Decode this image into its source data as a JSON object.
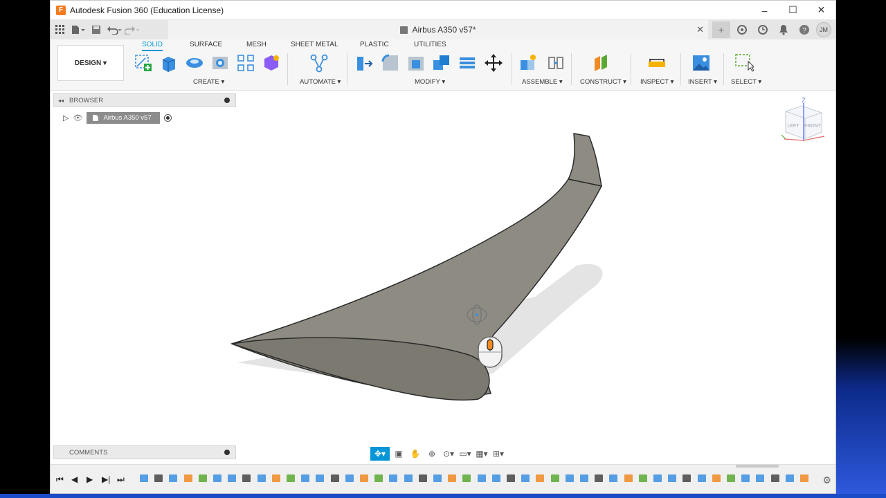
{
  "window": {
    "title": "Autodesk Fusion 360 (Education License)",
    "controls": [
      "–",
      "☐",
      "✕"
    ]
  },
  "document_tab": {
    "title": "Airbus A350 v57*"
  },
  "user": {
    "initials": "JM"
  },
  "ribbon": {
    "workspace": "DESIGN ▾",
    "tabs": [
      {
        "label": "SOLID",
        "active": true
      },
      {
        "label": "SURFACE",
        "active": false
      },
      {
        "label": "MESH",
        "active": false
      },
      {
        "label": "SHEET METAL",
        "active": false
      },
      {
        "label": "PLASTIC",
        "active": false
      },
      {
        "label": "UTILITIES",
        "active": false
      }
    ],
    "groups": [
      "CREATE ▾",
      "AUTOMATE ▾",
      "MODIFY ▾",
      "ASSEMBLE ▾",
      "CONSTRUCT ▾",
      "INSPECT ▾",
      "INSERT ▾",
      "SELECT ▾"
    ]
  },
  "browser": {
    "title": "BROWSER",
    "root_item": "Airbus A350 v57"
  },
  "comments": {
    "title": "COMMENTS"
  },
  "viewcube": {
    "left": "LEFT",
    "front": "FRONT",
    "axis": "Z"
  },
  "colors": {
    "accent": "#0696d7",
    "model_fill": "#8e8c82",
    "model_edge": "#2a2a2a",
    "toolbar_blue": "#3a8fe0"
  },
  "icons": {
    "nav": [
      "orbit-icon",
      "look-at-icon",
      "pan-icon",
      "zoom-icon",
      "fit-icon",
      "display-settings-icon",
      "grid-icon",
      "viewports-icon"
    ],
    "timeline_controls": [
      "first",
      "previous",
      "play",
      "next",
      "last"
    ]
  }
}
